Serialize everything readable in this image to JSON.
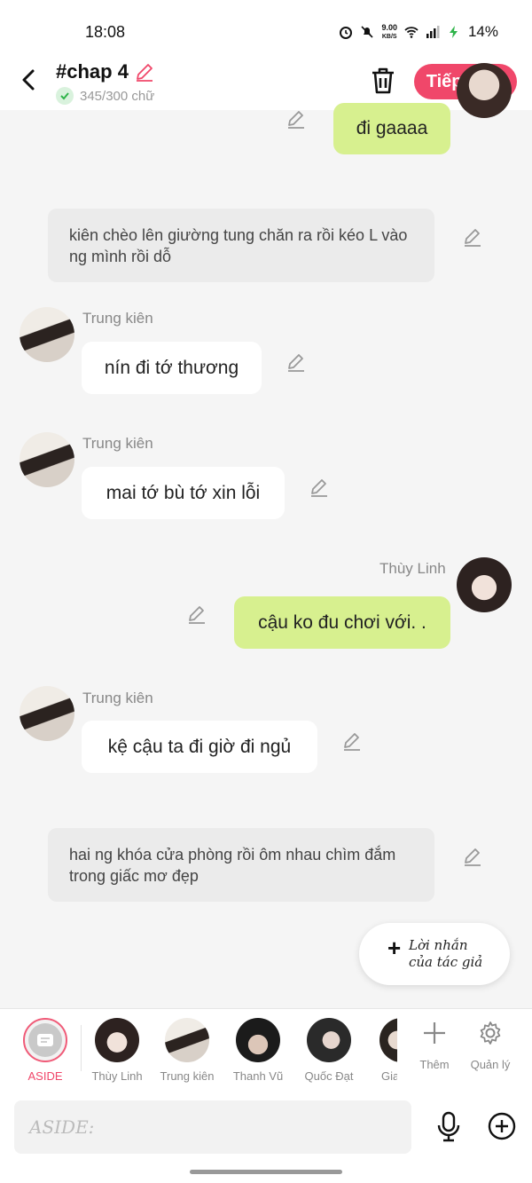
{
  "status_bar": {
    "time": "18:08",
    "speed": "9.00",
    "speed_unit": "KB/S",
    "battery": "14%"
  },
  "header": {
    "title": "#chap 4",
    "word_count": "345/300 chữ",
    "next_label": "Tiếp theo"
  },
  "messages": {
    "m1": {
      "text": "đi gaaaa"
    },
    "n1": {
      "text": "kiên chèo lên giường tung chăn ra rồi kéo L vào ng mình rồi dỗ"
    },
    "m2": {
      "name": "Trung kiên",
      "text": "nín đi tớ thương"
    },
    "m3": {
      "name": "Trung kiên",
      "text": "mai tớ bù tớ xin lỗi"
    },
    "m4": {
      "name": "Thùy Linh",
      "text": "cậu ko đu chơi với. ."
    },
    "m5": {
      "name": "Trung kiên",
      "text": "kệ cậu ta đi giờ đi ngủ"
    },
    "n2": {
      "text": "hai ng khóa cửa phòng rồi ôm nhau chìm đắm trong giấc mơ đẹp"
    }
  },
  "author_note": {
    "line1": "Lời nhắn",
    "line2": "của tác giả"
  },
  "characters": [
    {
      "label": "ASIDE"
    },
    {
      "label": "Thùy Linh"
    },
    {
      "label": "Trung kiên"
    },
    {
      "label": "Thanh Vũ"
    },
    {
      "label": "Quốc Đạt"
    },
    {
      "label": "Gia"
    }
  ],
  "tools": {
    "add_label": "Thêm",
    "manage_label": "Quản lý"
  },
  "input": {
    "placeholder": "ASIDE:"
  },
  "colors": {
    "accent": "#f0476a",
    "my_bubble": "#d7f08f",
    "other_bubble": "#ffffff",
    "narration": "#ebebeb"
  },
  "icons": [
    "back-icon",
    "edit-icon",
    "check-icon",
    "trash-icon",
    "pencil-icon",
    "plus-icon",
    "gear-icon",
    "mic-icon",
    "add-circle-icon",
    "aside-chat-icon"
  ]
}
